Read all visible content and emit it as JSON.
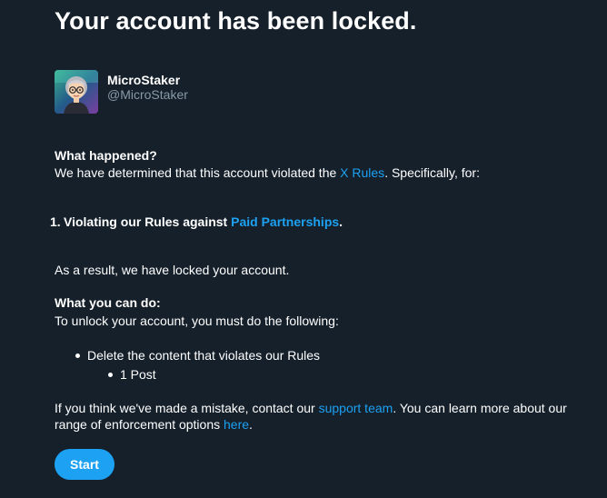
{
  "title": "Your account has been locked.",
  "account": {
    "name": "MicroStaker",
    "handle": "@MicroStaker",
    "avatar_icon": "memoji-avatar-icon"
  },
  "what_happened": {
    "heading": "What happened?",
    "text_before_link": "We have determined that this account violated the ",
    "link_text": "X Rules",
    "text_after_link": ". Specifically, for:"
  },
  "violations": [
    {
      "number": "1.",
      "text_before_link": "Violating our Rules against ",
      "link_text": "Paid Partnerships",
      "text_after_link": "."
    }
  ],
  "result_text": "As a result, we have locked your account.",
  "what_you_can_do": {
    "heading": "What you can do:",
    "intro": "To unlock your account, you must do the following:",
    "steps": [
      {
        "text": "Delete the content that violates our Rules",
        "sub_items": [
          "1 Post"
        ]
      }
    ]
  },
  "mistake": {
    "line1_before_link": "If you think we've made a mistake, contact our ",
    "line1_link": "support team",
    "line1_after_link": ". You can learn more about our",
    "line2_before_link": "range of enforcement options ",
    "line2_link": "here",
    "line2_after_link": "."
  },
  "start_button_label": "Start",
  "colors": {
    "background": "#15202b",
    "link": "#1da1f2",
    "secondary_text": "#8899a6",
    "button": "#1da1f2"
  }
}
